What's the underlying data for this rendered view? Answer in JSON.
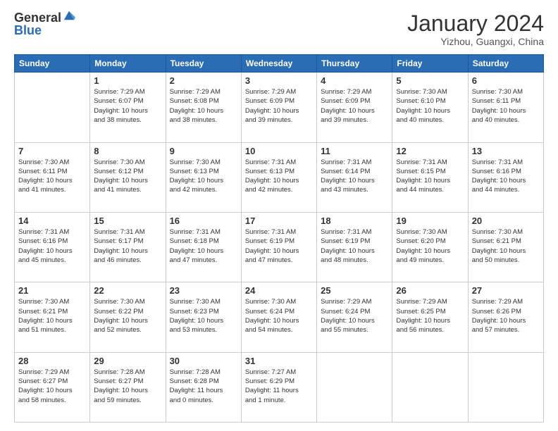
{
  "header": {
    "logo_general": "General",
    "logo_blue": "Blue",
    "title": "January 2024",
    "location": "Yizhou, Guangxi, China"
  },
  "days_of_week": [
    "Sunday",
    "Monday",
    "Tuesday",
    "Wednesday",
    "Thursday",
    "Friday",
    "Saturday"
  ],
  "weeks": [
    [
      {
        "day": "",
        "info": ""
      },
      {
        "day": "1",
        "info": "Sunrise: 7:29 AM\nSunset: 6:07 PM\nDaylight: 10 hours\nand 38 minutes."
      },
      {
        "day": "2",
        "info": "Sunrise: 7:29 AM\nSunset: 6:08 PM\nDaylight: 10 hours\nand 38 minutes."
      },
      {
        "day": "3",
        "info": "Sunrise: 7:29 AM\nSunset: 6:09 PM\nDaylight: 10 hours\nand 39 minutes."
      },
      {
        "day": "4",
        "info": "Sunrise: 7:29 AM\nSunset: 6:09 PM\nDaylight: 10 hours\nand 39 minutes."
      },
      {
        "day": "5",
        "info": "Sunrise: 7:30 AM\nSunset: 6:10 PM\nDaylight: 10 hours\nand 40 minutes."
      },
      {
        "day": "6",
        "info": "Sunrise: 7:30 AM\nSunset: 6:11 PM\nDaylight: 10 hours\nand 40 minutes."
      }
    ],
    [
      {
        "day": "7",
        "info": "Sunrise: 7:30 AM\nSunset: 6:11 PM\nDaylight: 10 hours\nand 41 minutes."
      },
      {
        "day": "8",
        "info": "Sunrise: 7:30 AM\nSunset: 6:12 PM\nDaylight: 10 hours\nand 41 minutes."
      },
      {
        "day": "9",
        "info": "Sunrise: 7:30 AM\nSunset: 6:13 PM\nDaylight: 10 hours\nand 42 minutes."
      },
      {
        "day": "10",
        "info": "Sunrise: 7:31 AM\nSunset: 6:13 PM\nDaylight: 10 hours\nand 42 minutes."
      },
      {
        "day": "11",
        "info": "Sunrise: 7:31 AM\nSunset: 6:14 PM\nDaylight: 10 hours\nand 43 minutes."
      },
      {
        "day": "12",
        "info": "Sunrise: 7:31 AM\nSunset: 6:15 PM\nDaylight: 10 hours\nand 44 minutes."
      },
      {
        "day": "13",
        "info": "Sunrise: 7:31 AM\nSunset: 6:16 PM\nDaylight: 10 hours\nand 44 minutes."
      }
    ],
    [
      {
        "day": "14",
        "info": "Sunrise: 7:31 AM\nSunset: 6:16 PM\nDaylight: 10 hours\nand 45 minutes."
      },
      {
        "day": "15",
        "info": "Sunrise: 7:31 AM\nSunset: 6:17 PM\nDaylight: 10 hours\nand 46 minutes."
      },
      {
        "day": "16",
        "info": "Sunrise: 7:31 AM\nSunset: 6:18 PM\nDaylight: 10 hours\nand 47 minutes."
      },
      {
        "day": "17",
        "info": "Sunrise: 7:31 AM\nSunset: 6:19 PM\nDaylight: 10 hours\nand 47 minutes."
      },
      {
        "day": "18",
        "info": "Sunrise: 7:31 AM\nSunset: 6:19 PM\nDaylight: 10 hours\nand 48 minutes."
      },
      {
        "day": "19",
        "info": "Sunrise: 7:30 AM\nSunset: 6:20 PM\nDaylight: 10 hours\nand 49 minutes."
      },
      {
        "day": "20",
        "info": "Sunrise: 7:30 AM\nSunset: 6:21 PM\nDaylight: 10 hours\nand 50 minutes."
      }
    ],
    [
      {
        "day": "21",
        "info": "Sunrise: 7:30 AM\nSunset: 6:21 PM\nDaylight: 10 hours\nand 51 minutes."
      },
      {
        "day": "22",
        "info": "Sunrise: 7:30 AM\nSunset: 6:22 PM\nDaylight: 10 hours\nand 52 minutes."
      },
      {
        "day": "23",
        "info": "Sunrise: 7:30 AM\nSunset: 6:23 PM\nDaylight: 10 hours\nand 53 minutes."
      },
      {
        "day": "24",
        "info": "Sunrise: 7:30 AM\nSunset: 6:24 PM\nDaylight: 10 hours\nand 54 minutes."
      },
      {
        "day": "25",
        "info": "Sunrise: 7:29 AM\nSunset: 6:24 PM\nDaylight: 10 hours\nand 55 minutes."
      },
      {
        "day": "26",
        "info": "Sunrise: 7:29 AM\nSunset: 6:25 PM\nDaylight: 10 hours\nand 56 minutes."
      },
      {
        "day": "27",
        "info": "Sunrise: 7:29 AM\nSunset: 6:26 PM\nDaylight: 10 hours\nand 57 minutes."
      }
    ],
    [
      {
        "day": "28",
        "info": "Sunrise: 7:29 AM\nSunset: 6:27 PM\nDaylight: 10 hours\nand 58 minutes."
      },
      {
        "day": "29",
        "info": "Sunrise: 7:28 AM\nSunset: 6:27 PM\nDaylight: 10 hours\nand 59 minutes."
      },
      {
        "day": "30",
        "info": "Sunrise: 7:28 AM\nSunset: 6:28 PM\nDaylight: 11 hours\nand 0 minutes."
      },
      {
        "day": "31",
        "info": "Sunrise: 7:27 AM\nSunset: 6:29 PM\nDaylight: 11 hours\nand 1 minute."
      },
      {
        "day": "",
        "info": ""
      },
      {
        "day": "",
        "info": ""
      },
      {
        "day": "",
        "info": ""
      }
    ]
  ]
}
